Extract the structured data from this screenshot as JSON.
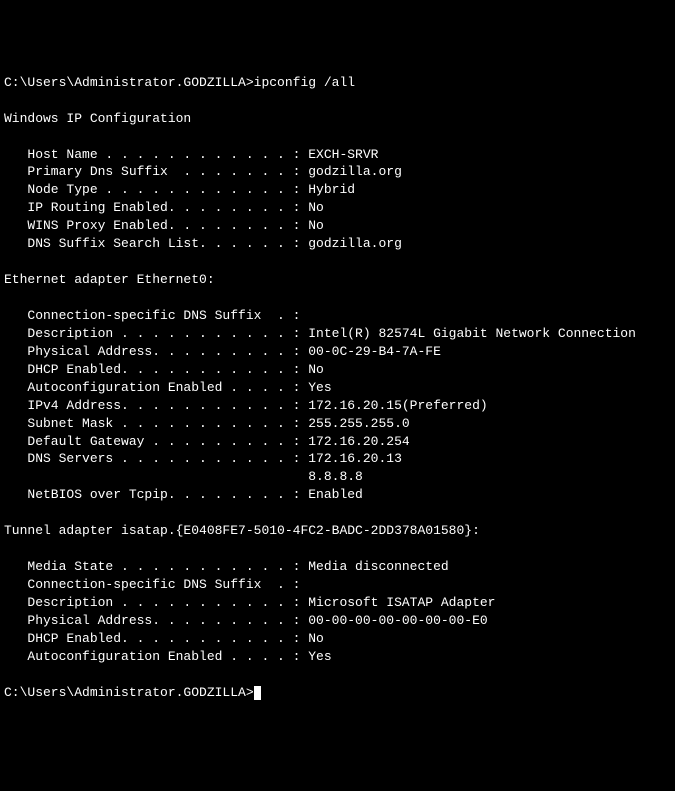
{
  "prompt1": "C:\\Users\\Administrator.GODZILLA>",
  "command": "ipconfig /all",
  "blank": "",
  "header": "Windows IP Configuration",
  "config_lines": [
    "   Host Name . . . . . . . . . . . . : EXCH-SRVR",
    "   Primary Dns Suffix  . . . . . . . : godzilla.org",
    "   Node Type . . . . . . . . . . . . : Hybrid",
    "   IP Routing Enabled. . . . . . . . : No",
    "   WINS Proxy Enabled. . . . . . . . : No",
    "   DNS Suffix Search List. . . . . . : godzilla.org"
  ],
  "adapter1_header": "Ethernet adapter Ethernet0:",
  "adapter1_lines": [
    "   Connection-specific DNS Suffix  . :",
    "   Description . . . . . . . . . . . : Intel(R) 82574L Gigabit Network Connection",
    "   Physical Address. . . . . . . . . : 00-0C-29-B4-7A-FE",
    "   DHCP Enabled. . . . . . . . . . . : No",
    "   Autoconfiguration Enabled . . . . : Yes",
    "   IPv4 Address. . . . . . . . . . . : 172.16.20.15(Preferred)",
    "   Subnet Mask . . . . . . . . . . . : 255.255.255.0",
    "   Default Gateway . . . . . . . . . : 172.16.20.254",
    "   DNS Servers . . . . . . . . . . . : 172.16.20.13",
    "                                       8.8.8.8",
    "   NetBIOS over Tcpip. . . . . . . . : Enabled"
  ],
  "adapter2_header": "Tunnel adapter isatap.{E0408FE7-5010-4FC2-BADC-2DD378A01580}:",
  "adapter2_lines": [
    "   Media State . . . . . . . . . . . : Media disconnected",
    "   Connection-specific DNS Suffix  . :",
    "   Description . . . . . . . . . . . : Microsoft ISATAP Adapter",
    "   Physical Address. . . . . . . . . : 00-00-00-00-00-00-00-E0",
    "   DHCP Enabled. . . . . . . . . . . : No",
    "   Autoconfiguration Enabled . . . . : Yes"
  ],
  "prompt2": "C:\\Users\\Administrator.GODZILLA>"
}
